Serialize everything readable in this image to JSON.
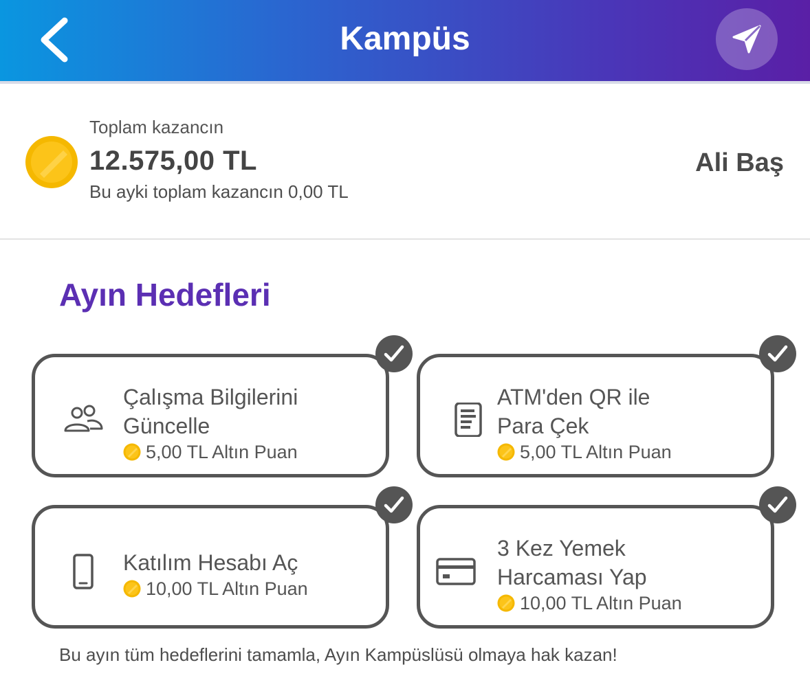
{
  "header": {
    "title": "Kampüs",
    "back_icon": "chevron-left-icon",
    "send_icon": "paper-plane-icon",
    "gradient": [
      "#0a96e0",
      "#5a1fa6"
    ]
  },
  "earnings": {
    "label": "Toplam kazancın",
    "total": "12.575,00 TL",
    "month_text": "Bu ayki toplam kazancın 0,00 TL",
    "user_name": "Ali Baş",
    "coin_color": "#f5b800"
  },
  "goals": {
    "title": "Ayın Hedefleri",
    "accent": "#5b2fb3",
    "items": [
      {
        "line1": "Çalışma Bilgilerini",
        "line2": "Güncelle",
        "points": "5,00 TL Altın Puan",
        "icon": "people-icon",
        "done": true
      },
      {
        "line1": "ATM'den QR ile",
        "line2": "Para Çek",
        "points": "5,00 TL Altın Puan",
        "icon": "document-icon",
        "done": true
      },
      {
        "line1": "Katılım Hesabı Aç",
        "line2": "",
        "points": "10,00 TL Altın Puan",
        "icon": "phone-icon",
        "done": true
      },
      {
        "line1": "3 Kez Yemek",
        "line2": "Harcaması Yap",
        "points": "10,00 TL Altın Puan",
        "icon": "credit-card-icon",
        "done": true
      }
    ],
    "footer": "Bu ayın tüm hedeflerini tamamla, Ayın Kampüslüsü olmaya hak kazan!"
  }
}
